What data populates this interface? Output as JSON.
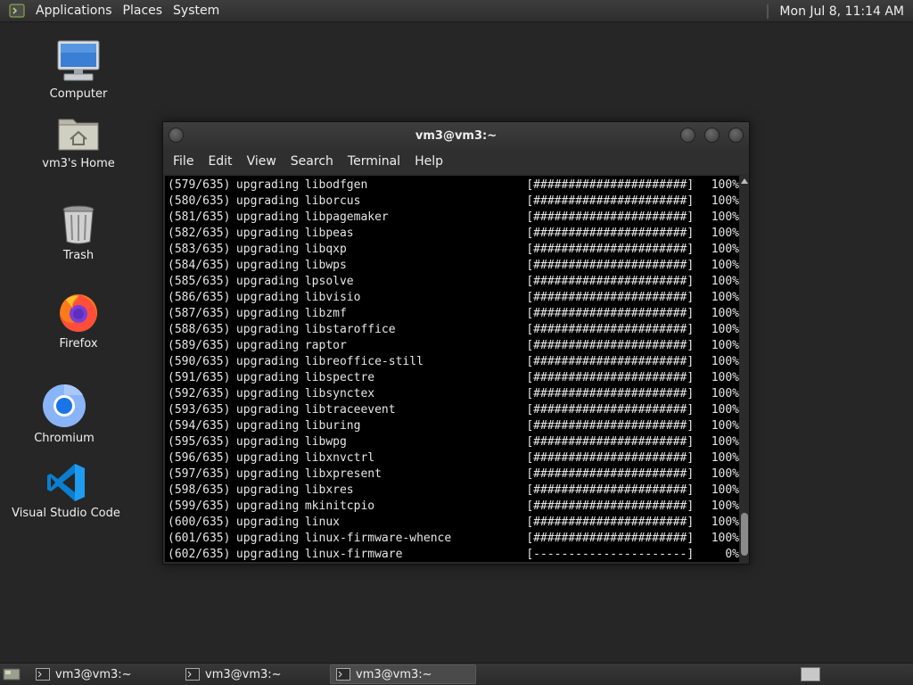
{
  "top_panel": {
    "menus": [
      "Applications",
      "Places",
      "System"
    ],
    "clock": "Mon Jul  8, 11:14 AM"
  },
  "desktop": {
    "icons": [
      {
        "label": "Computer",
        "icon": "computer-icon"
      },
      {
        "label": "vm3's Home",
        "icon": "home-folder-icon"
      },
      {
        "label": "Trash",
        "icon": "trash-icon"
      },
      {
        "label": "Firefox",
        "icon": "firefox-icon"
      },
      {
        "label": "Chromium",
        "icon": "chromium-icon"
      },
      {
        "label": "Visual Studio Code",
        "icon": "vscode-icon"
      }
    ]
  },
  "terminal": {
    "title": "vm3@vm3:~",
    "menu": [
      "File",
      "Edit",
      "View",
      "Search",
      "Terminal",
      "Help"
    ],
    "lines": [
      {
        "progress": "(579/635)",
        "action": "upgrading",
        "package": "libodfgen",
        "bar": "[######################]",
        "percent": "100%"
      },
      {
        "progress": "(580/635)",
        "action": "upgrading",
        "package": "liborcus",
        "bar": "[######################]",
        "percent": "100%"
      },
      {
        "progress": "(581/635)",
        "action": "upgrading",
        "package": "libpagemaker",
        "bar": "[######################]",
        "percent": "100%"
      },
      {
        "progress": "(582/635)",
        "action": "upgrading",
        "package": "libpeas",
        "bar": "[######################]",
        "percent": "100%"
      },
      {
        "progress": "(583/635)",
        "action": "upgrading",
        "package": "libqxp",
        "bar": "[######################]",
        "percent": "100%"
      },
      {
        "progress": "(584/635)",
        "action": "upgrading",
        "package": "libwps",
        "bar": "[######################]",
        "percent": "100%"
      },
      {
        "progress": "(585/635)",
        "action": "upgrading",
        "package": "lpsolve",
        "bar": "[######################]",
        "percent": "100%"
      },
      {
        "progress": "(586/635)",
        "action": "upgrading",
        "package": "libvisio",
        "bar": "[######################]",
        "percent": "100%"
      },
      {
        "progress": "(587/635)",
        "action": "upgrading",
        "package": "libzmf",
        "bar": "[######################]",
        "percent": "100%"
      },
      {
        "progress": "(588/635)",
        "action": "upgrading",
        "package": "libstaroffice",
        "bar": "[######################]",
        "percent": "100%"
      },
      {
        "progress": "(589/635)",
        "action": "upgrading",
        "package": "raptor",
        "bar": "[######################]",
        "percent": "100%"
      },
      {
        "progress": "(590/635)",
        "action": "upgrading",
        "package": "libreoffice-still",
        "bar": "[######################]",
        "percent": "100%"
      },
      {
        "progress": "(591/635)",
        "action": "upgrading",
        "package": "libspectre",
        "bar": "[######################]",
        "percent": "100%"
      },
      {
        "progress": "(592/635)",
        "action": "upgrading",
        "package": "libsynctex",
        "bar": "[######################]",
        "percent": "100%"
      },
      {
        "progress": "(593/635)",
        "action": "upgrading",
        "package": "libtraceevent",
        "bar": "[######################]",
        "percent": "100%"
      },
      {
        "progress": "(594/635)",
        "action": "upgrading",
        "package": "liburing",
        "bar": "[######################]",
        "percent": "100%"
      },
      {
        "progress": "(595/635)",
        "action": "upgrading",
        "package": "libwpg",
        "bar": "[######################]",
        "percent": "100%"
      },
      {
        "progress": "(596/635)",
        "action": "upgrading",
        "package": "libxnvctrl",
        "bar": "[######################]",
        "percent": "100%"
      },
      {
        "progress": "(597/635)",
        "action": "upgrading",
        "package": "libxpresent",
        "bar": "[######################]",
        "percent": "100%"
      },
      {
        "progress": "(598/635)",
        "action": "upgrading",
        "package": "libxres",
        "bar": "[######################]",
        "percent": "100%"
      },
      {
        "progress": "(599/635)",
        "action": "upgrading",
        "package": "mkinitcpio",
        "bar": "[######################]",
        "percent": "100%"
      },
      {
        "progress": "(600/635)",
        "action": "upgrading",
        "package": "linux",
        "bar": "[######################]",
        "percent": "100%"
      },
      {
        "progress": "(601/635)",
        "action": "upgrading",
        "package": "linux-firmware-whence",
        "bar": "[######################]",
        "percent": "100%"
      },
      {
        "progress": "(602/635)",
        "action": "upgrading",
        "package": "linux-firmware",
        "bar": "[----------------------]",
        "percent": "0%"
      }
    ]
  },
  "taskbar": {
    "tasks": [
      {
        "label": "vm3@vm3:~",
        "active": false
      },
      {
        "label": "vm3@vm3:~",
        "active": false
      },
      {
        "label": "vm3@vm3:~",
        "active": true
      }
    ]
  }
}
